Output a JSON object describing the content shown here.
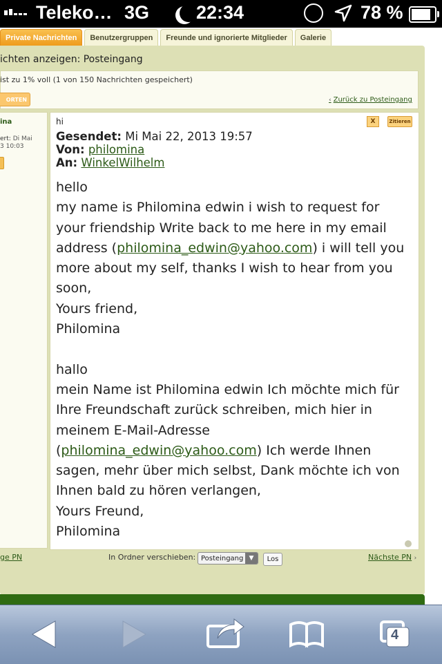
{
  "status_bar": {
    "carrier": "Teleko…",
    "network": "3G",
    "time": "22:34",
    "battery": "78 %"
  },
  "tabs": [
    {
      "label": "Private Nachrichten",
      "active": true
    },
    {
      "label": "Benutzergruppen",
      "active": false
    },
    {
      "label": "Freunde und ignorierte Mitglieder",
      "active": false
    },
    {
      "label": "Galerie",
      "active": false
    }
  ],
  "page": {
    "title": "ichten anzeigen: Posteingang",
    "storage_info": "ist zu 1% voll (1 von 150 Nachrichten gespeichert)",
    "reply_button": "ORTEN",
    "back_link": "Zurück zu Posteingang"
  },
  "sidebar": {
    "author": "ina",
    "registered_label": "ert:",
    "registered_value": "Di Mai",
    "registered_time": "3 10:03"
  },
  "message": {
    "subject": "hi",
    "delete_label": "X",
    "quote_label": "Zitieren",
    "sent_label": "Gesendet:",
    "sent_value": "Mi Mai 22, 2013 19:57",
    "from_label": "Von:",
    "from_value": "philomina",
    "to_label": "An:",
    "to_value": "WinkelWilhelm",
    "email": "philomina_edwin@yahoo.com",
    "lines": {
      "l1": "hello",
      "l2": "my name is Philomina edwin i wish to request for",
      "l3": "your friendship Write back to me here in my email",
      "l4a": "address (",
      "l4b": ") i will tell you",
      "l5": "more about my self, thanks I wish to hear from you",
      "l6": "soon,",
      "l7": "Yours friend,",
      "l8": "Philomina",
      "l9": "hallo",
      "l10": "mein Name ist Philomina edwin Ich möchte mich für",
      "l11": "Ihre Freundschaft zurück schreiben, mich hier in",
      "l12": "meinem E-Mail-Adresse",
      "l13a": "(",
      "l13b": ") Ich werde Ihnen",
      "l14": "sagen, mehr über mich selbst, Dank möchte ich von",
      "l15": "Ihnen bald zu hören verlangen,",
      "l16": "Yours Freund,",
      "l17": "Philomina"
    }
  },
  "footer": {
    "prev_link": "ge PN",
    "move_label": "In Ordner verschieben:",
    "folder_value": "Posteingang",
    "go_button": "Los",
    "next_link": "Nächste PN"
  },
  "browser_toolbar": {
    "tab_count": "4"
  }
}
